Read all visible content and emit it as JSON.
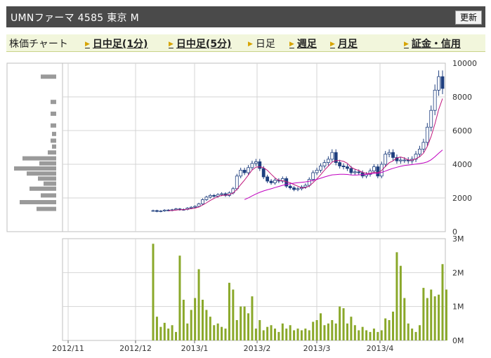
{
  "header": {
    "title": "UMNファーマ  4585  東京 M",
    "refresh_label": "更新",
    "bg_color": "#4a4a4a"
  },
  "nav": {
    "chart_label": "株価チャート",
    "items": [
      {
        "label": "日中足(1分)",
        "link": true
      },
      {
        "label": "日中足(5分)",
        "link": true
      },
      {
        "label": "日足",
        "link": false
      },
      {
        "label": "週足",
        "link": true
      },
      {
        "label": "月足",
        "link": true
      }
    ],
    "margin_label": "証金・信用"
  },
  "chart_data": {
    "type": "candlestick",
    "price_axis": {
      "ticks": [
        "10000",
        "8000",
        "6000",
        "4000",
        "2000",
        "0"
      ],
      "range": [
        0,
        10000
      ]
    },
    "volume_axis": {
      "ticks": [
        "3M",
        "2M",
        "1M",
        "0M"
      ],
      "range": [
        0,
        3000000
      ]
    },
    "x_ticks": [
      "2012/11",
      "2012/12",
      "2013/1",
      "2013/2",
      "2013/3",
      "2013/4"
    ],
    "colors": {
      "up": "#ffffff",
      "down": "#1f3f7f",
      "ma_short": "#c0187c",
      "ma_long": "#c000c0",
      "volume": "#8aa82a",
      "volume_profile": "#9a9a9a",
      "grid": "#d4d4d4"
    },
    "closes": [
      1250,
      1200,
      1230,
      1280,
      1260,
      1300,
      1350,
      1300,
      1320,
      1400,
      1450,
      1500,
      1650,
      1900,
      2050,
      2150,
      2100,
      2200,
      2250,
      2150,
      2300,
      2550,
      3300,
      3650,
      3500,
      3800,
      4050,
      4150,
      3750,
      3250,
      3000,
      2900,
      3050,
      3000,
      3150,
      2700,
      2600,
      2500,
      2550,
      2650,
      2750,
      3100,
      3500,
      3650,
      3900,
      4100,
      4300,
      4700,
      4100,
      3900,
      3850,
      3750,
      3500,
      3550,
      3500,
      3300,
      3400,
      3600,
      3850,
      3300,
      4000,
      4600,
      4700,
      4400,
      4200,
      4250,
      4250,
      4200,
      4300,
      4600,
      4900,
      5300,
      6200,
      7200,
      8400,
      9200,
      8500
    ],
    "volumes": [
      2850000,
      700000,
      400000,
      520000,
      350000,
      450000,
      250000,
      2500000,
      1200000,
      500000,
      900000,
      1250000,
      2100000,
      1200000,
      900000,
      700000,
      450000,
      500000,
      400000,
      350000,
      1700000,
      1500000,
      600000,
      1000000,
      1000000,
      800000,
      1300000,
      350000,
      600000,
      300000,
      400000,
      450000,
      350000,
      250000,
      500000,
      350000,
      450000,
      300000,
      350000,
      300000,
      350000,
      300000,
      550000,
      600000,
      800000,
      450000,
      500000,
      600000,
      500000,
      1000000,
      950000,
      500000,
      700000,
      450000,
      300000,
      400000,
      300000,
      250000,
      350000,
      250000,
      300000,
      650000,
      600000,
      850000,
      2600000,
      2200000,
      1250000,
      500000,
      350000,
      250000,
      450000,
      1550000,
      1250000,
      1500000,
      1300000,
      1350000,
      2250000,
      1500000
    ],
    "volume_profile": [
      {
        "price": 9200,
        "width": 22
      },
      {
        "price": 7700,
        "width": 8
      },
      {
        "price": 7000,
        "width": 8
      },
      {
        "price": 6300,
        "width": 8
      },
      {
        "price": 5800,
        "width": 6
      },
      {
        "price": 5400,
        "width": 8
      },
      {
        "price": 5050,
        "width": 6
      },
      {
        "price": 4700,
        "width": 12
      },
      {
        "price": 4350,
        "width": 48
      },
      {
        "price": 4050,
        "width": 24
      },
      {
        "price": 3750,
        "width": 60
      },
      {
        "price": 3450,
        "width": 42
      },
      {
        "price": 3150,
        "width": 26
      },
      {
        "price": 2850,
        "width": 18
      },
      {
        "price": 2550,
        "width": 38
      },
      {
        "price": 2150,
        "width": 22
      },
      {
        "price": 1750,
        "width": 52
      },
      {
        "price": 1350,
        "width": 28
      }
    ]
  }
}
